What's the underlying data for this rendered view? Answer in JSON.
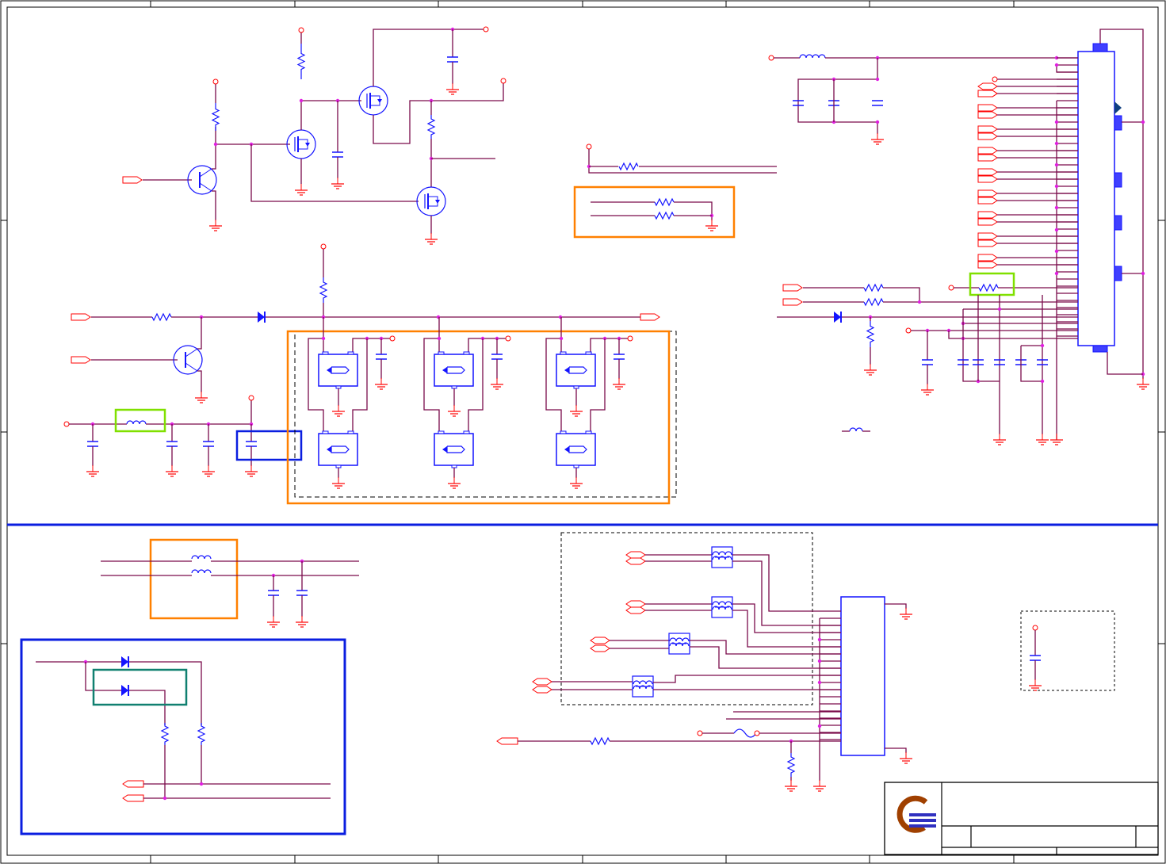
{
  "colors": {
    "wire": "#7a0a4a",
    "component": "#1414ff",
    "pin": "#ff0000",
    "junction": "#e020e0",
    "frame": "#000000",
    "divider": "#0a1ee0",
    "highlight_orange": "#ff8000",
    "highlight_green": "#80e000",
    "highlight_blue": "#0a1ee0",
    "highlight_teal": "#108070",
    "logo_ring": "#a04000",
    "logo_bars": "#3030c0"
  },
  "components": [
    "resistor",
    "capacitor",
    "inductor",
    "diode",
    "bjt-transistor",
    "mosfet",
    "relay",
    "common-mode-choke",
    "fuse",
    "connector",
    "ground",
    "port"
  ],
  "title_block": {
    "logo": "company-logo"
  }
}
